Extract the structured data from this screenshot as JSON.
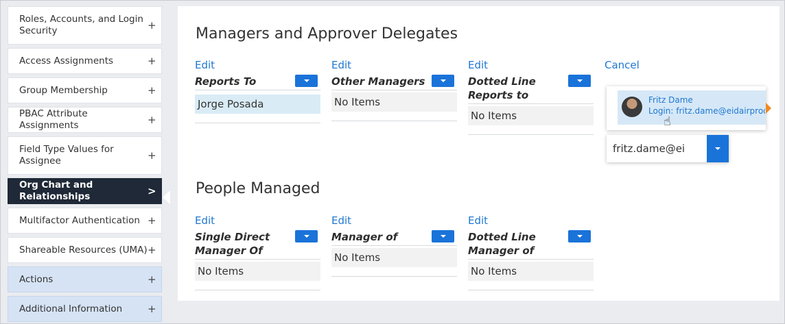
{
  "sidebar": {
    "items": [
      {
        "label": "Roles, Accounts, and Login Security",
        "icon": "+"
      },
      {
        "label": "Access Assignments",
        "icon": "+"
      },
      {
        "label": "Group Membership",
        "icon": "+"
      },
      {
        "label": "PBAC Attribute Assignments",
        "icon": "+"
      },
      {
        "label": "Field Type Values for Assignee",
        "icon": "+"
      },
      {
        "label": "Org Chart and Relationships",
        "icon": ">"
      },
      {
        "label": "Multifactor Authentication",
        "icon": "+"
      },
      {
        "label": "Shareable Resources (UMA)",
        "icon": "+"
      },
      {
        "label": "Actions",
        "icon": "+"
      },
      {
        "label": "Additional Information",
        "icon": "+"
      }
    ]
  },
  "managers": {
    "title": "Managers and Approver Delegates",
    "columns": [
      {
        "action": "Edit",
        "name": "Reports To",
        "value": "Jorge Posada"
      },
      {
        "action": "Edit",
        "name": "Other Managers",
        "value": "No Items"
      },
      {
        "action": "Edit",
        "name": "Dotted Line Reports to",
        "value": "No Items"
      },
      {
        "action": "Cancel"
      }
    ]
  },
  "people": {
    "title": "People Managed",
    "columns": [
      {
        "action": "Edit",
        "name": "Single Direct Manager Of",
        "value": "No Items"
      },
      {
        "action": "Edit",
        "name": "Manager of",
        "value": "No Items"
      },
      {
        "action": "Edit",
        "name": "Dotted Line Manager of",
        "value": "No Items"
      }
    ]
  },
  "popup": {
    "name": "Fritz Dame",
    "login": "Login: fritz.dame@eidairprod..."
  },
  "search": {
    "value": "fritz.dame@ei"
  },
  "colors": {
    "accent": "#1a73d9",
    "active_nav": "#1f2937",
    "highlight_nav": "#d6e3f5"
  }
}
